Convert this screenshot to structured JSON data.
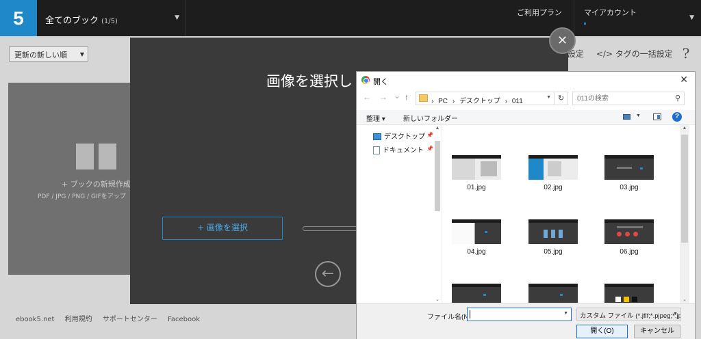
{
  "topbar": {
    "logo": "5",
    "book_select": {
      "label": "全てのブック",
      "count": "(1/5)"
    },
    "plan_link": "ご利用プラン",
    "account_label": "マイアカウント"
  },
  "page": {
    "sort_label": "更新の新しい順",
    "right_tools": {
      "settings_fragment": "設定",
      "bulk_tag": "</> タグの一括設定",
      "help": "?"
    },
    "new_book": {
      "title": "+ ブックの新規作成",
      "formats": "PDF / JPG / PNG / GIFをアップ"
    },
    "footer_links": [
      "ebook5.net",
      "利用規約",
      "サポートセンター",
      "Facebook"
    ]
  },
  "modal": {
    "title": "画像を選択し",
    "select_button": "+ 画像を選択",
    "close": "✕",
    "back": "←"
  },
  "dialog": {
    "title": "開く",
    "close": "✕",
    "nav": {
      "back": "←",
      "forward": "→",
      "recent": "⌄",
      "up": "↑"
    },
    "breadcrumbs": [
      "›",
      "PC",
      "›",
      "デスクトップ",
      "›",
      "011"
    ],
    "refresh": "↻",
    "search_placeholder": "011の検索",
    "search_icon": "⚲",
    "organize": "整理 ▾",
    "new_folder": "新しいフォルダー",
    "help": "?",
    "nav_items": [
      {
        "label": "デスクトップ",
        "icon": "desktop-icon",
        "color": "#3d8fd9"
      },
      {
        "label": "ドキュメント",
        "icon": "document-icon",
        "color": "#6d8fb3"
      }
    ],
    "files": [
      "01.jpg",
      "02.jpg",
      "03.jpg",
      "04.jpg",
      "05.jpg",
      "06.jpg",
      "",
      "",
      ""
    ],
    "filename_label": "ファイル名(N):",
    "filename_value": "",
    "filter": "カスタム ファイル (*.jfif;*.pjpeg;*.jp",
    "open_button": "開く(O)",
    "cancel_button": "キャンセル"
  },
  "colors": {
    "accent": "#1e88c9",
    "topbar": "#1d1d1d",
    "modal": "#3a3a3a"
  }
}
